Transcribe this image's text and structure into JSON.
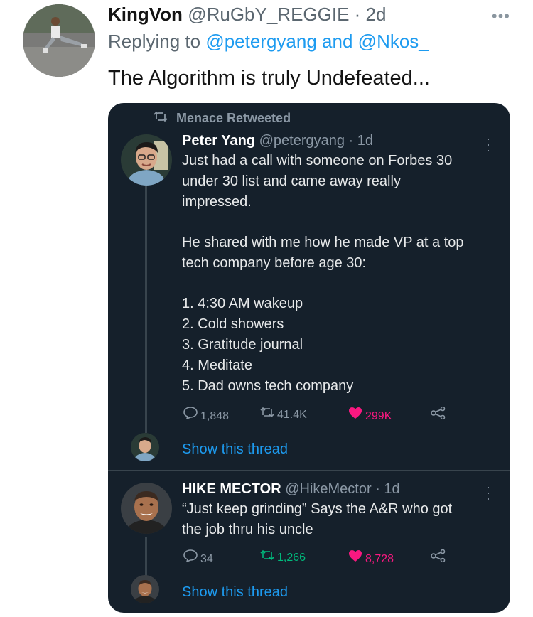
{
  "outer": {
    "name": "KingVon",
    "handle": "@RuGbY_REGGIE",
    "time": "2d",
    "replying_prefix": "Replying to",
    "replying_to_1": "@petergyang",
    "replying_and": "and",
    "replying_to_2": "@Nkos_",
    "text": "The Algorithm is truly Undefeated..."
  },
  "card": {
    "retweet_label": "Menace Retweeted",
    "tweet1": {
      "name": "Peter Yang",
      "handle": "@petergyang",
      "time": "1d",
      "lines": [
        "Just had a call with someone on Forbes 30",
        "under 30 list and came away really",
        "impressed.",
        "",
        "He shared with me how he made VP at a top",
        "tech company before age 30:",
        "",
        "1. 4:30 AM wakeup",
        "2. Cold showers",
        "3. Gratitude journal",
        "4. Meditate",
        "5. Dad owns tech company"
      ],
      "replies": "1,848",
      "retweets": "41.4K",
      "likes": "299K",
      "show_thread": "Show this thread"
    },
    "tweet2": {
      "name": "HIKE MECTOR",
      "handle": "@HikeMector",
      "time": "1d",
      "lines": [
        "“Just keep grinding” Says the A&R who got",
        "the job thru his uncle"
      ],
      "replies": "34",
      "retweets": "1,266",
      "likes": "8,728",
      "show_thread": "Show this thread"
    }
  },
  "icons": {
    "more": "more-horizontal-icon",
    "retweet": "retweet-icon",
    "reply": "reply-bubble-icon",
    "like": "heart-icon",
    "share": "share-icon"
  },
  "colors": {
    "link": "#1d9bf0",
    "card_bg": "#15202b",
    "retweet_green": "#00ba7c",
    "like_pink": "#f91880"
  }
}
